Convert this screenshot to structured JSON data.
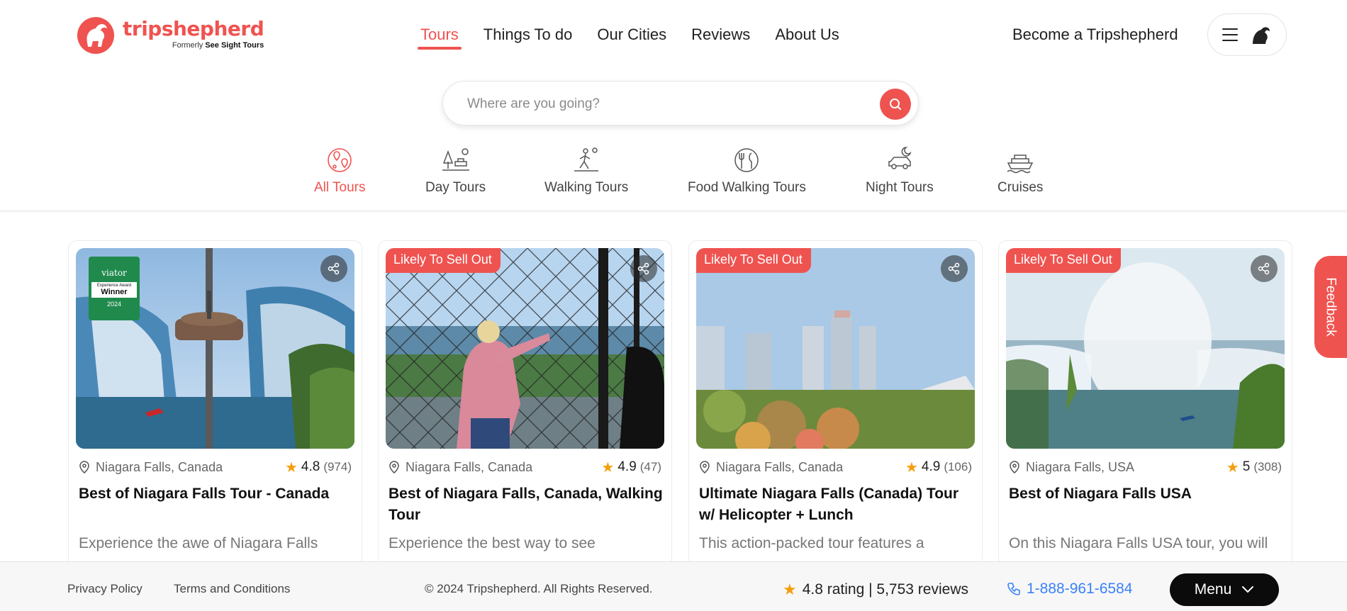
{
  "brand": {
    "name": "tripshepherd",
    "tagline_prefix": "Formerly",
    "tagline_brand": "See Sight Tours",
    "accent_color": "#ef5350"
  },
  "nav": {
    "items": [
      {
        "label": "Tours",
        "active": true
      },
      {
        "label": "Things To do",
        "active": false
      },
      {
        "label": "Our Cities",
        "active": false
      },
      {
        "label": "Reviews",
        "active": false
      },
      {
        "label": "About Us",
        "active": false
      }
    ],
    "become_label": "Become a Tripshepherd"
  },
  "search": {
    "placeholder": "Where are you going?",
    "value": ""
  },
  "categories": [
    {
      "label": "All Tours",
      "icon": "map-pins-icon",
      "active": true
    },
    {
      "label": "Day Tours",
      "icon": "day-tours-icon",
      "active": false
    },
    {
      "label": "Walking Tours",
      "icon": "walking-icon",
      "active": false
    },
    {
      "label": "Food Walking Tours",
      "icon": "food-icon",
      "active": false
    },
    {
      "label": "Night Tours",
      "icon": "night-car-icon",
      "active": false
    },
    {
      "label": "Cruises",
      "icon": "ship-icon",
      "active": false
    }
  ],
  "cards": [
    {
      "badge": "",
      "award": {
        "brand": "viator",
        "line1": "Experience Award",
        "line2": "Winner",
        "year": "2024"
      },
      "location": "Niagara Falls, Canada",
      "rating": "4.8",
      "reviews": "(974)",
      "title": "Best of Niagara Falls Tour - Canada",
      "description": "Experience the awe of Niagara Falls"
    },
    {
      "badge": "Likely To Sell Out",
      "location": "Niagara Falls, Canada",
      "rating": "4.9",
      "reviews": "(47)",
      "title": "Best of Niagara Falls, Canada, Walking Tour",
      "description": "Experience the best way to see"
    },
    {
      "badge": "Likely To Sell Out",
      "location": "Niagara Falls, Canada",
      "rating": "4.9",
      "reviews": "(106)",
      "title": "Ultimate Niagara Falls (Canada) Tour w/ Helicopter + Lunch",
      "description": "This action-packed tour features a"
    },
    {
      "badge": "Likely To Sell Out",
      "location": "Niagara Falls, USA",
      "rating": "5",
      "reviews": "(308)",
      "title": "Best of Niagara Falls USA",
      "description": "On this Niagara Falls USA tour, you will"
    }
  ],
  "feedback_label": "Feedback",
  "footer": {
    "privacy": "Privacy Policy",
    "terms": "Terms and Conditions",
    "copyright": "© 2024 Tripshepherd. All Rights Reserved.",
    "rating_text": "4.8 rating | 5,753 reviews",
    "phone": "1-888-961-6584",
    "menu_label": "Menu"
  }
}
